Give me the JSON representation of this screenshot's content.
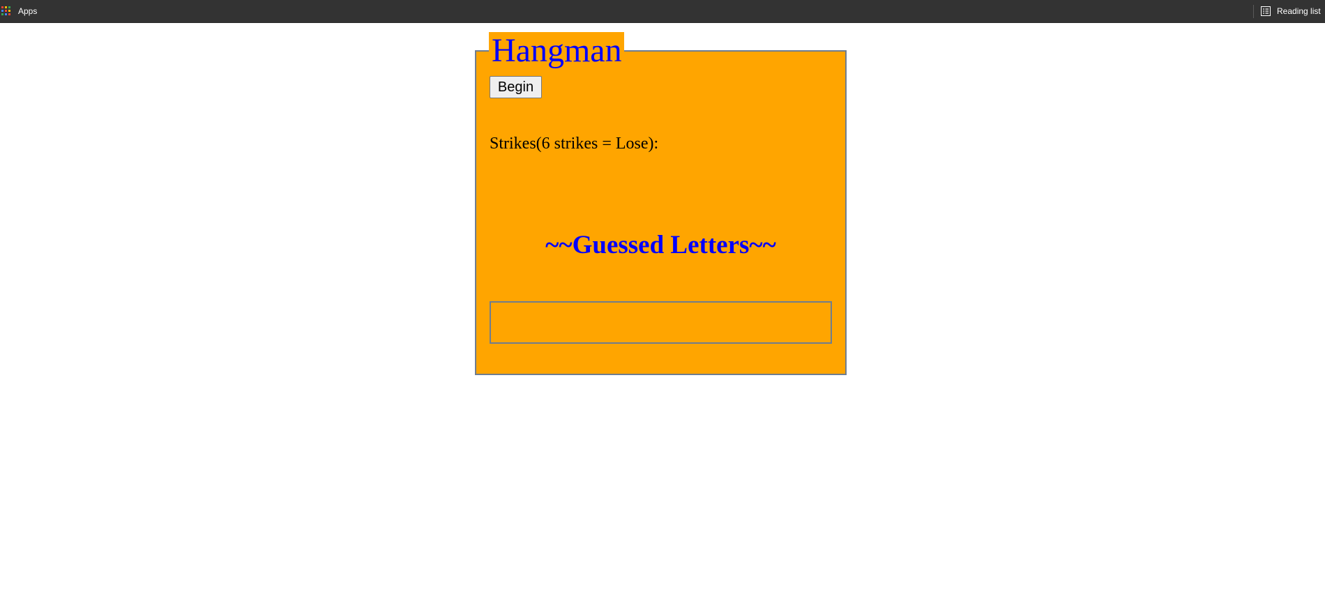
{
  "bookmarks_bar": {
    "apps_label": "Apps",
    "apps_icon": "apps-grid-icon",
    "reading_list_label": "Reading list",
    "reading_list_icon": "reading-list-icon",
    "background_color": "#333333"
  },
  "game": {
    "title": "Hangman",
    "begin_label": "Begin",
    "strikes_label": "Strikes(6 strikes = Lose):",
    "guessed_heading": "~~Guessed Letters~~",
    "guessed_letters": "",
    "colors": {
      "background": "#ffa500",
      "title": "#0000ff",
      "border": "#6f7d8f"
    }
  }
}
